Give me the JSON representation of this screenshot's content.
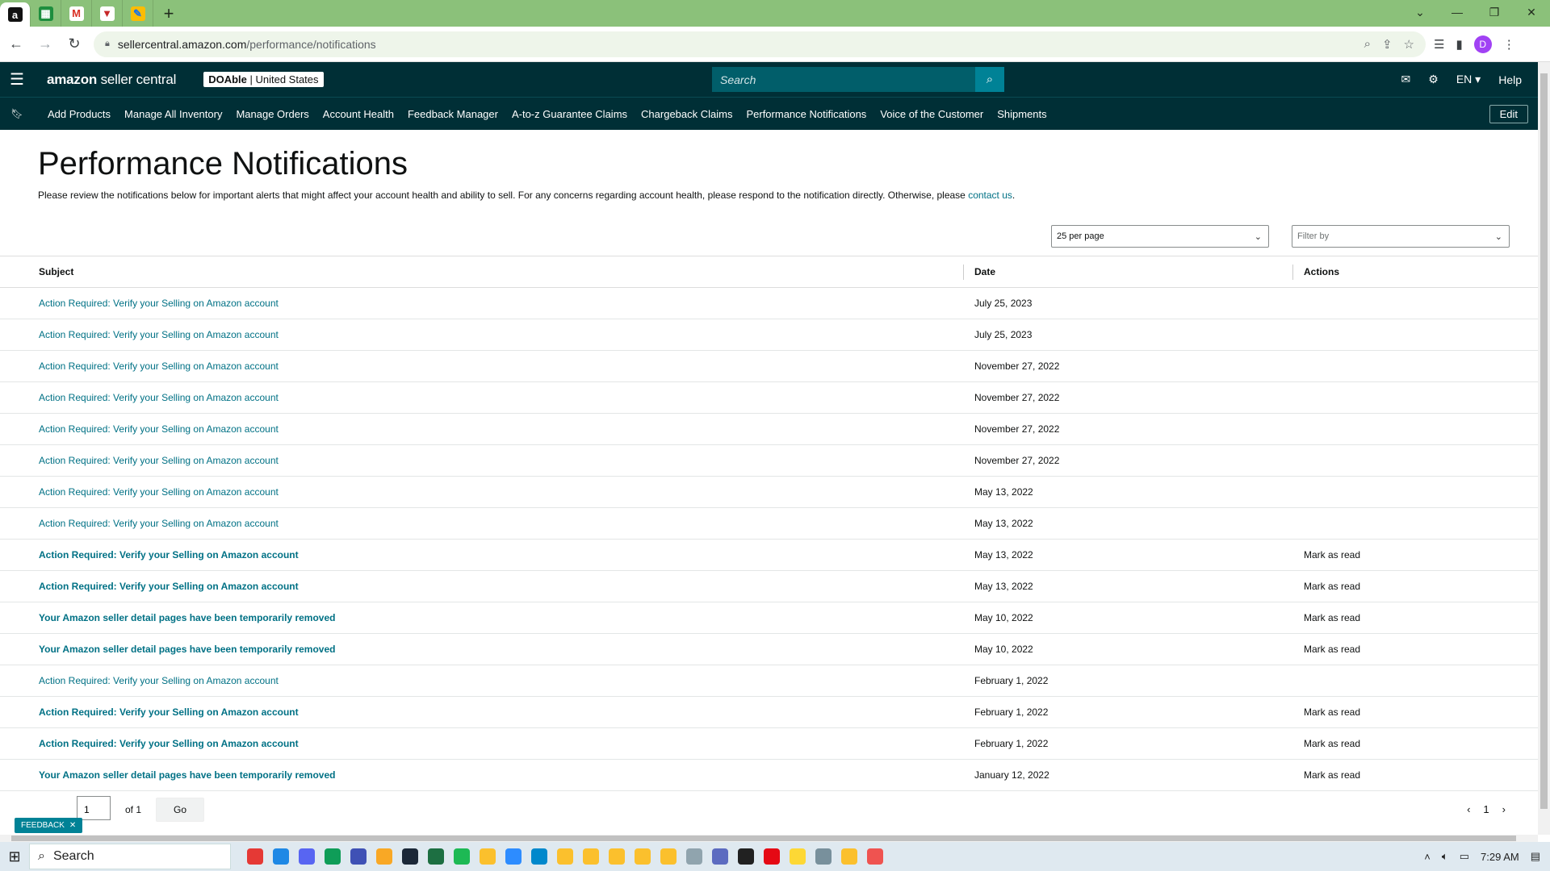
{
  "browser": {
    "url_host": "sellercentral.amazon.com",
    "url_path": "/performance/notifications",
    "profile_initial": "D"
  },
  "header": {
    "logo_bold": "amazon",
    "logo_light": " seller central",
    "account_name": "DOAble",
    "account_region": " | United States",
    "search_placeholder": "Search",
    "language": "EN",
    "help": "Help"
  },
  "nav": {
    "items": [
      "Add Products",
      "Manage All Inventory",
      "Manage Orders",
      "Account Health",
      "Feedback Manager",
      "A-to-z Guarantee Claims",
      "Chargeback Claims",
      "Performance Notifications",
      "Voice of the Customer",
      "Shipments"
    ],
    "edit": "Edit"
  },
  "page": {
    "title": "Performance Notifications",
    "intro": "Please review the notifications below for important alerts that might affect your account health and ability to sell. For any concerns regarding account health, please respond to the notification directly. Otherwise, please ",
    "intro_link": "contact us",
    "intro_end": "."
  },
  "controls": {
    "per_page": "25 per page",
    "filter": "Filter by"
  },
  "table": {
    "headers": {
      "subject": "Subject",
      "date": "Date",
      "actions": "Actions"
    },
    "rows": [
      {
        "subject": "Action Required: Verify your Selling on Amazon account",
        "date": "July 25, 2023",
        "action": "",
        "unread": false
      },
      {
        "subject": "Action Required: Verify your Selling on Amazon account",
        "date": "July 25, 2023",
        "action": "",
        "unread": false
      },
      {
        "subject": "Action Required: Verify your Selling on Amazon account",
        "date": "November 27, 2022",
        "action": "",
        "unread": false
      },
      {
        "subject": "Action Required: Verify your Selling on Amazon account",
        "date": "November 27, 2022",
        "action": "",
        "unread": false
      },
      {
        "subject": "Action Required: Verify your Selling on Amazon account",
        "date": "November 27, 2022",
        "action": "",
        "unread": false
      },
      {
        "subject": "Action Required: Verify your Selling on Amazon account",
        "date": "November 27, 2022",
        "action": "",
        "unread": false
      },
      {
        "subject": "Action Required: Verify your Selling on Amazon account",
        "date": "May 13, 2022",
        "action": "",
        "unread": false
      },
      {
        "subject": "Action Required: Verify your Selling on Amazon account",
        "date": "May 13, 2022",
        "action": "",
        "unread": false
      },
      {
        "subject": "Action Required: Verify your Selling on Amazon account",
        "date": "May 13, 2022",
        "action": "Mark as read",
        "unread": true
      },
      {
        "subject": "Action Required: Verify your Selling on Amazon account",
        "date": "May 13, 2022",
        "action": "Mark as read",
        "unread": true
      },
      {
        "subject": "Your Amazon seller detail pages have been temporarily removed",
        "date": "May 10, 2022",
        "action": "Mark as read",
        "unread": true
      },
      {
        "subject": "Your Amazon seller detail pages have been temporarily removed",
        "date": "May 10, 2022",
        "action": "Mark as read",
        "unread": true
      },
      {
        "subject": "Action Required: Verify your Selling on Amazon account",
        "date": "February 1, 2022",
        "action": "",
        "unread": false
      },
      {
        "subject": "Action Required: Verify your Selling on Amazon account",
        "date": "February 1, 2022",
        "action": "Mark as read",
        "unread": true
      },
      {
        "subject": "Action Required: Verify your Selling on Amazon account",
        "date": "February 1, 2022",
        "action": "Mark as read",
        "unread": true
      },
      {
        "subject": "Your Amazon seller detail pages have been temporarily removed",
        "date": "January 12, 2022",
        "action": "Mark as read",
        "unread": true
      }
    ]
  },
  "pagination": {
    "page_value": "1",
    "of_label": "of 1",
    "go": "Go",
    "current_page": "1"
  },
  "feedback": "FEEDBACK",
  "taskbar": {
    "search": "Search",
    "time": "7:29 AM"
  },
  "colors": {
    "header_bg": "#002f36",
    "link": "#007185",
    "tabbar": "#8bc17a"
  }
}
